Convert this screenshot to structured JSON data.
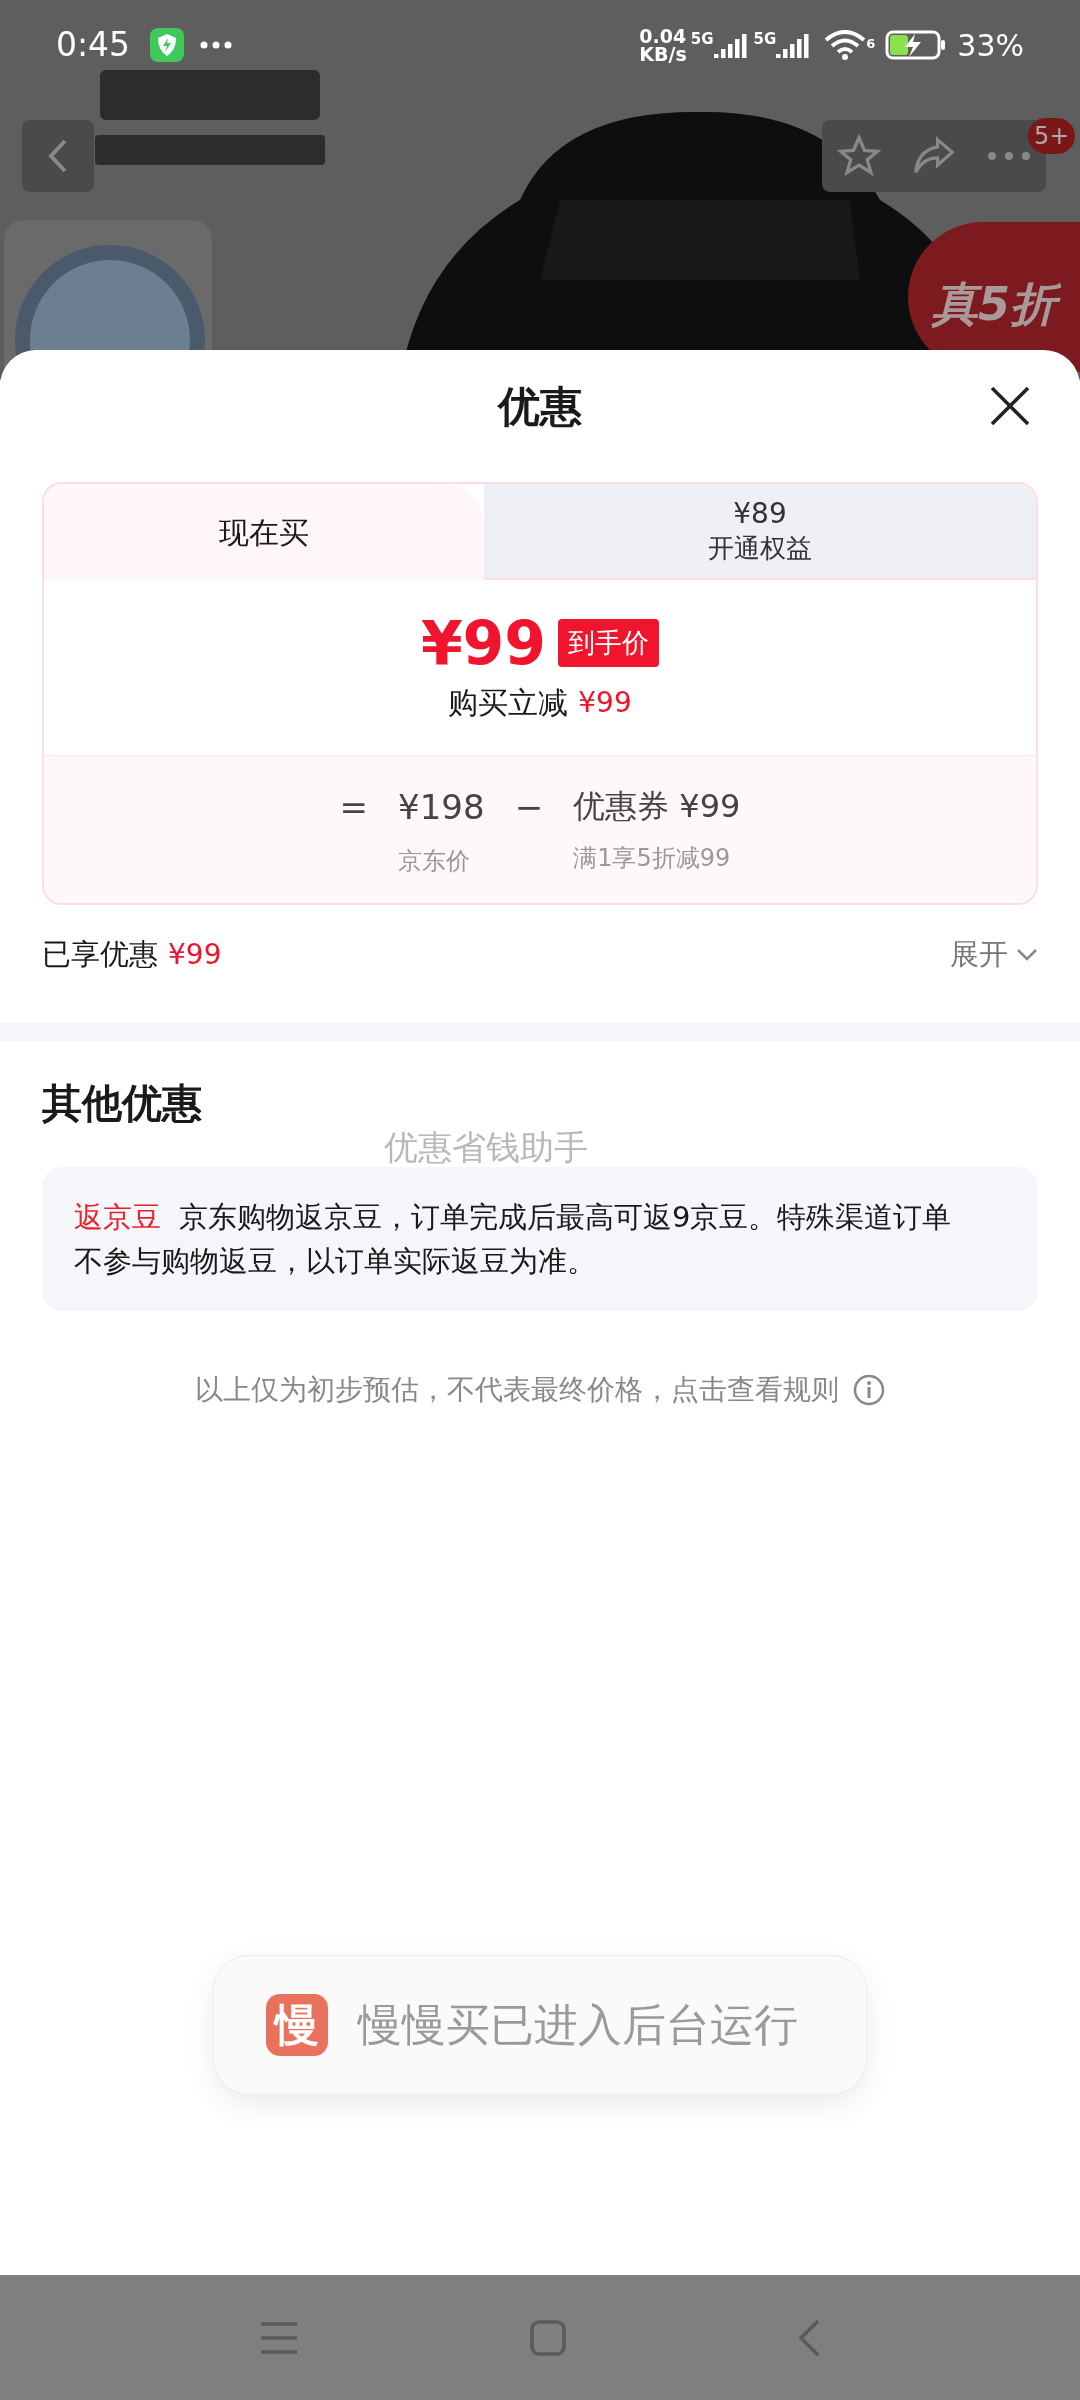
{
  "status_bar": {
    "time": "0:45",
    "speed": "0.04",
    "speed_unit": "KB/s",
    "network_1": "5G",
    "network_2": "5G",
    "wifi_band": "6",
    "battery": "33%"
  },
  "product_page": {
    "badge_count": "5+",
    "promo_tag": "真5折"
  },
  "sheet": {
    "title": "优惠",
    "tabs": [
      {
        "label": "现在买",
        "selected": true
      },
      {
        "price": "¥89",
        "label": "开通权益",
        "selected": false
      }
    ],
    "final_price": "¥99",
    "final_price_tag": "到手价",
    "reduction_label": "购买立减",
    "reduction_amount": "¥99",
    "formula": {
      "equals": "=",
      "base_price": "¥198",
      "base_label": "京东价",
      "minus": "−",
      "coupon": "优惠券 ¥99",
      "coupon_label": "满1享5折减99"
    },
    "enjoyed_label": "已享优惠",
    "enjoyed_amount": "¥99",
    "expand_label": "展开",
    "expanded": false,
    "other_title": "其他优惠",
    "overlay_hint": "优惠省钱助手",
    "other_items": [
      {
        "tag": "返京豆",
        "text": "京东购物返京豆，订单完成后最高可返9京豆。特殊渠道订单不参与购物返豆，以订单实际返豆为准。"
      }
    ],
    "disclaimer": "以上仅为初步预估，不代表最终价格，点击查看规则"
  },
  "toast": {
    "app_icon_text": "慢",
    "message": "慢慢买已进入后台运行"
  }
}
